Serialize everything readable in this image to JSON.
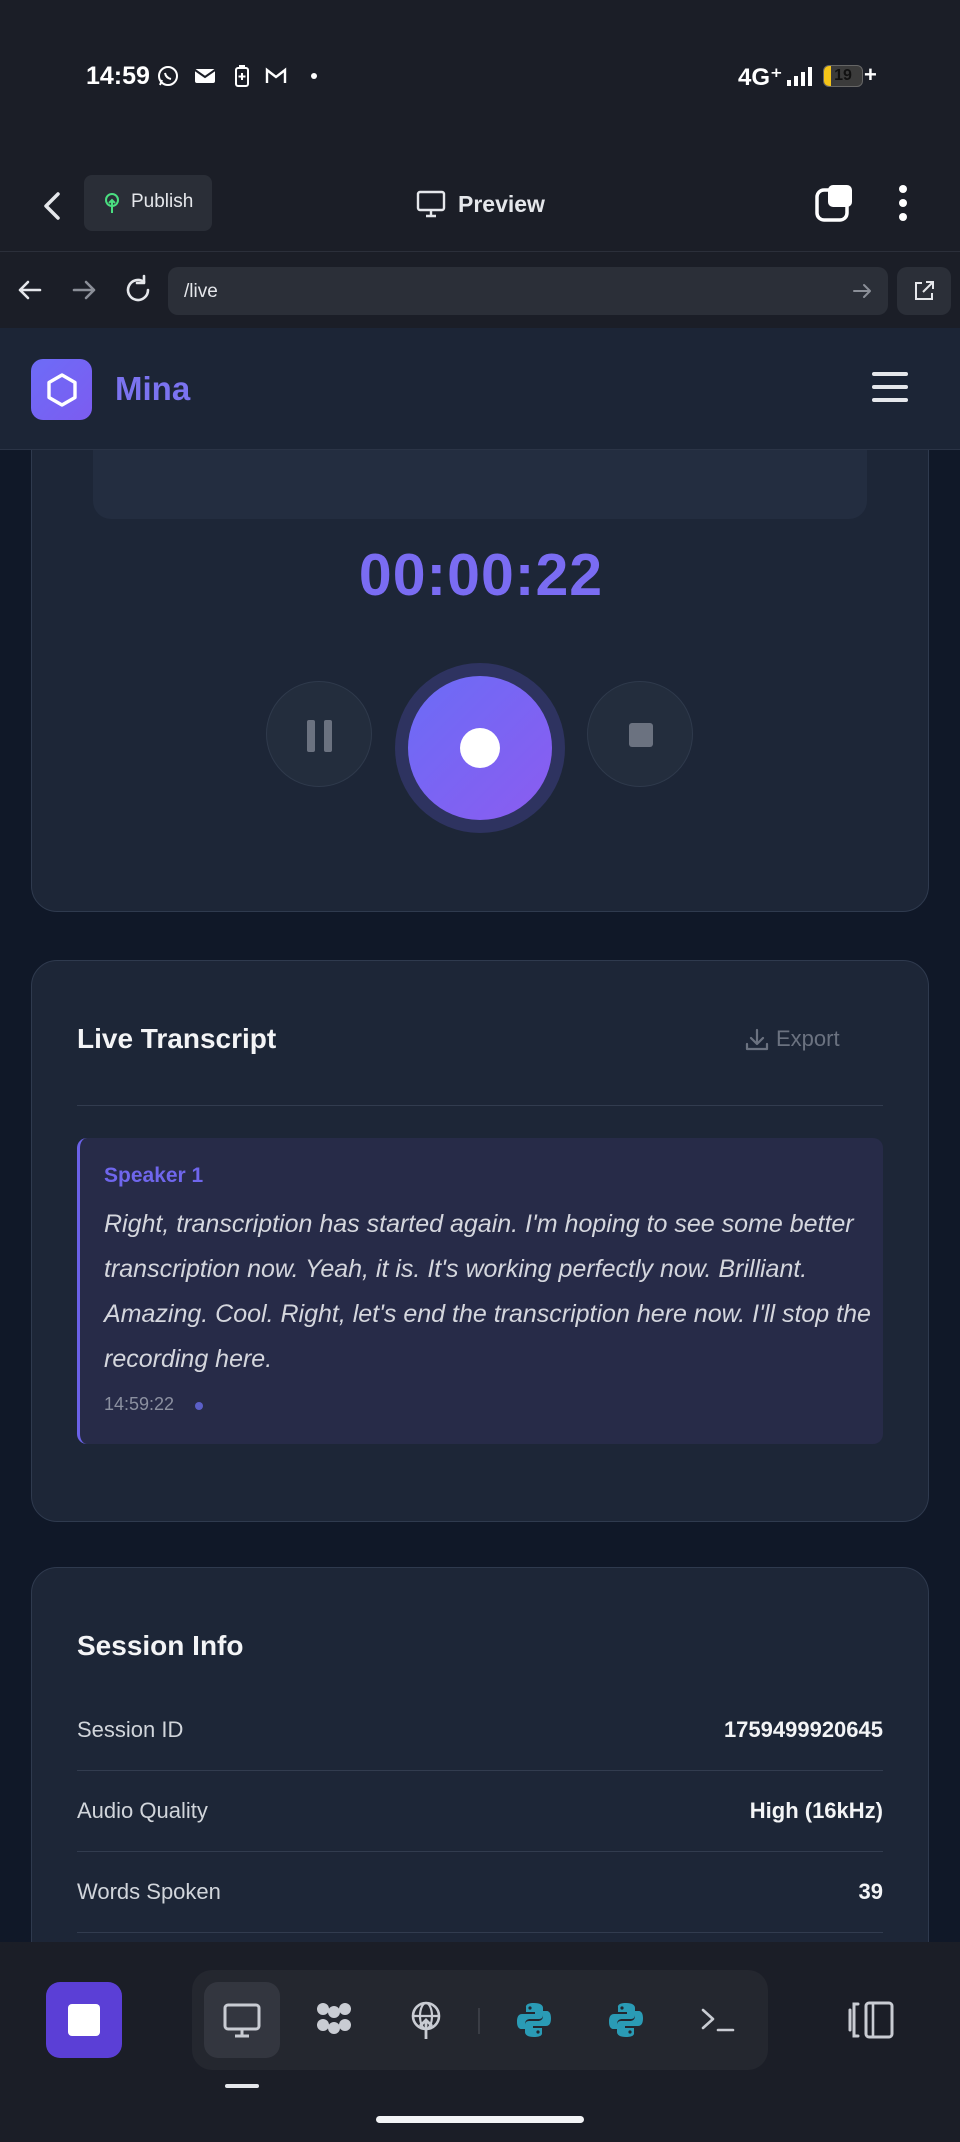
{
  "status_bar": {
    "time": "14:59",
    "network": "4G⁺",
    "battery_percent": "19",
    "battery_level": 0.19,
    "charging_symbol": "+",
    "icons": [
      "whatsapp-icon",
      "mail-icon",
      "battery-saver-icon",
      "gmail-icon",
      "dot-icon",
      "signal-icon"
    ]
  },
  "app_header": {
    "publish_label": "Publish",
    "preview_label": "Preview"
  },
  "browser": {
    "url": "/live"
  },
  "site": {
    "brand": "Mina"
  },
  "recorder": {
    "timer": "00:00:22"
  },
  "transcript": {
    "title": "Live Transcript",
    "export_label": "Export",
    "entries": [
      {
        "speaker": "Speaker 1",
        "text": "Right, transcription has started again. I'm hoping to see some better transcription now. Yeah, it is. It's working perfectly now. Brilliant. Amazing. Cool. Right, let's end the transcription here now. I'll stop the recording here.",
        "time": "14:59:22"
      }
    ]
  },
  "session": {
    "title": "Session Info",
    "rows": [
      {
        "label": "Session ID",
        "value": "1759499920645"
      },
      {
        "label": "Audio Quality",
        "value": "High (16kHz)"
      },
      {
        "label": "Words Spoken",
        "value": "39"
      }
    ]
  },
  "colors": {
    "accent": "#7b73f0",
    "record_gradient_start": "#6b6cf6",
    "record_gradient_end": "#8b5cf0",
    "card_background": "#1d2637",
    "page_background": "#101828"
  }
}
